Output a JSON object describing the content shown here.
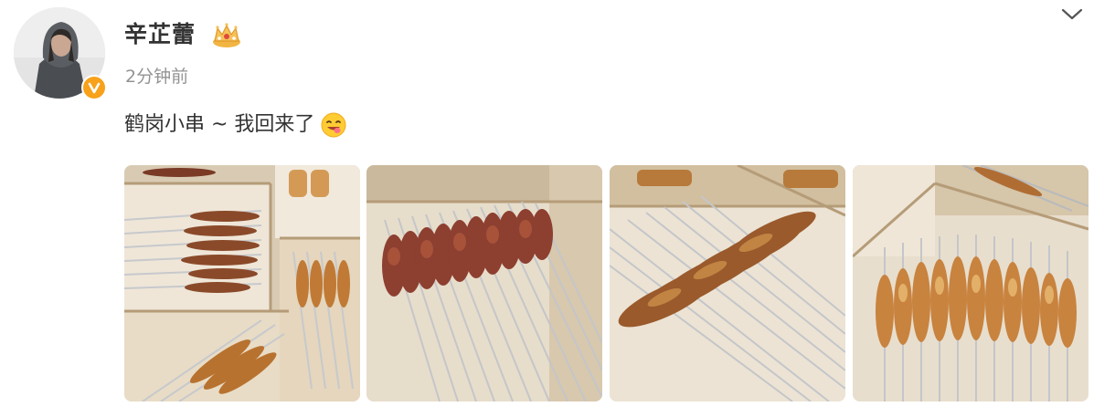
{
  "post": {
    "username": "辛芷蕾",
    "timestamp": "2分钟前",
    "text": "鹤岗小串 ~ 我回来了",
    "emoji": "yum-face-emoji",
    "badges": {
      "verified": "verified-v-icon",
      "crown": "crown-badge-icon"
    },
    "menu_icon": "chevron-down-icon",
    "photos": [
      {
        "name": "photo-skewers-boxes"
      },
      {
        "name": "photo-skewers-red-meat"
      },
      {
        "name": "photo-skewers-grilled"
      },
      {
        "name": "photo-skewers-spiced"
      }
    ]
  },
  "colors": {
    "verified_badge": "#f7a21a",
    "username": "#333333",
    "timestamp": "#939393"
  }
}
